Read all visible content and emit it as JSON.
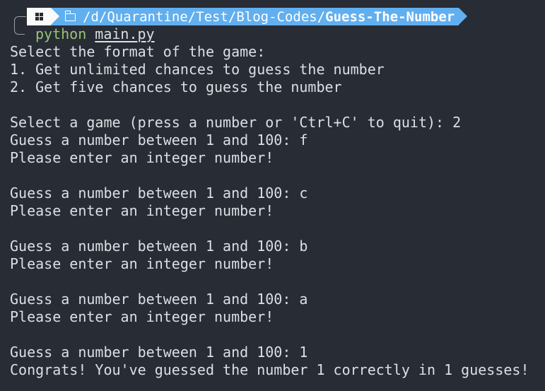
{
  "prompt": {
    "path_prefix": "/d/Quarantine/Test/Blog-Codes/",
    "path_current": "Guess-The-Number"
  },
  "command": {
    "program": "python",
    "argument": "main.py"
  },
  "output_lines": [
    "Select the format of the game:",
    "1. Get unlimited chances to guess the number",
    "2. Get five chances to guess the number",
    "",
    "Select a game (press a number or 'Ctrl+C' to quit): 2",
    "Guess a number between 1 and 100: f",
    "Please enter an integer number!",
    "",
    "Guess a number between 1 and 100: c",
    "Please enter an integer number!",
    "",
    "Guess a number between 1 and 100: b",
    "Please enter an integer number!",
    "",
    "Guess a number between 1 and 100: a",
    "Please enter an integer number!",
    "",
    "Guess a number between 1 and 100: 1",
    "Congrats! You've guessed the number 1 correctly in 1 guesses!"
  ],
  "colors": {
    "background": "#282c34",
    "text": "#dcdfe4",
    "path_segment": "#61afef",
    "os_segment": "#fafafa",
    "command_program": "#98c379"
  },
  "icons": {
    "os": "windows-icon",
    "folder": "folder-icon"
  }
}
